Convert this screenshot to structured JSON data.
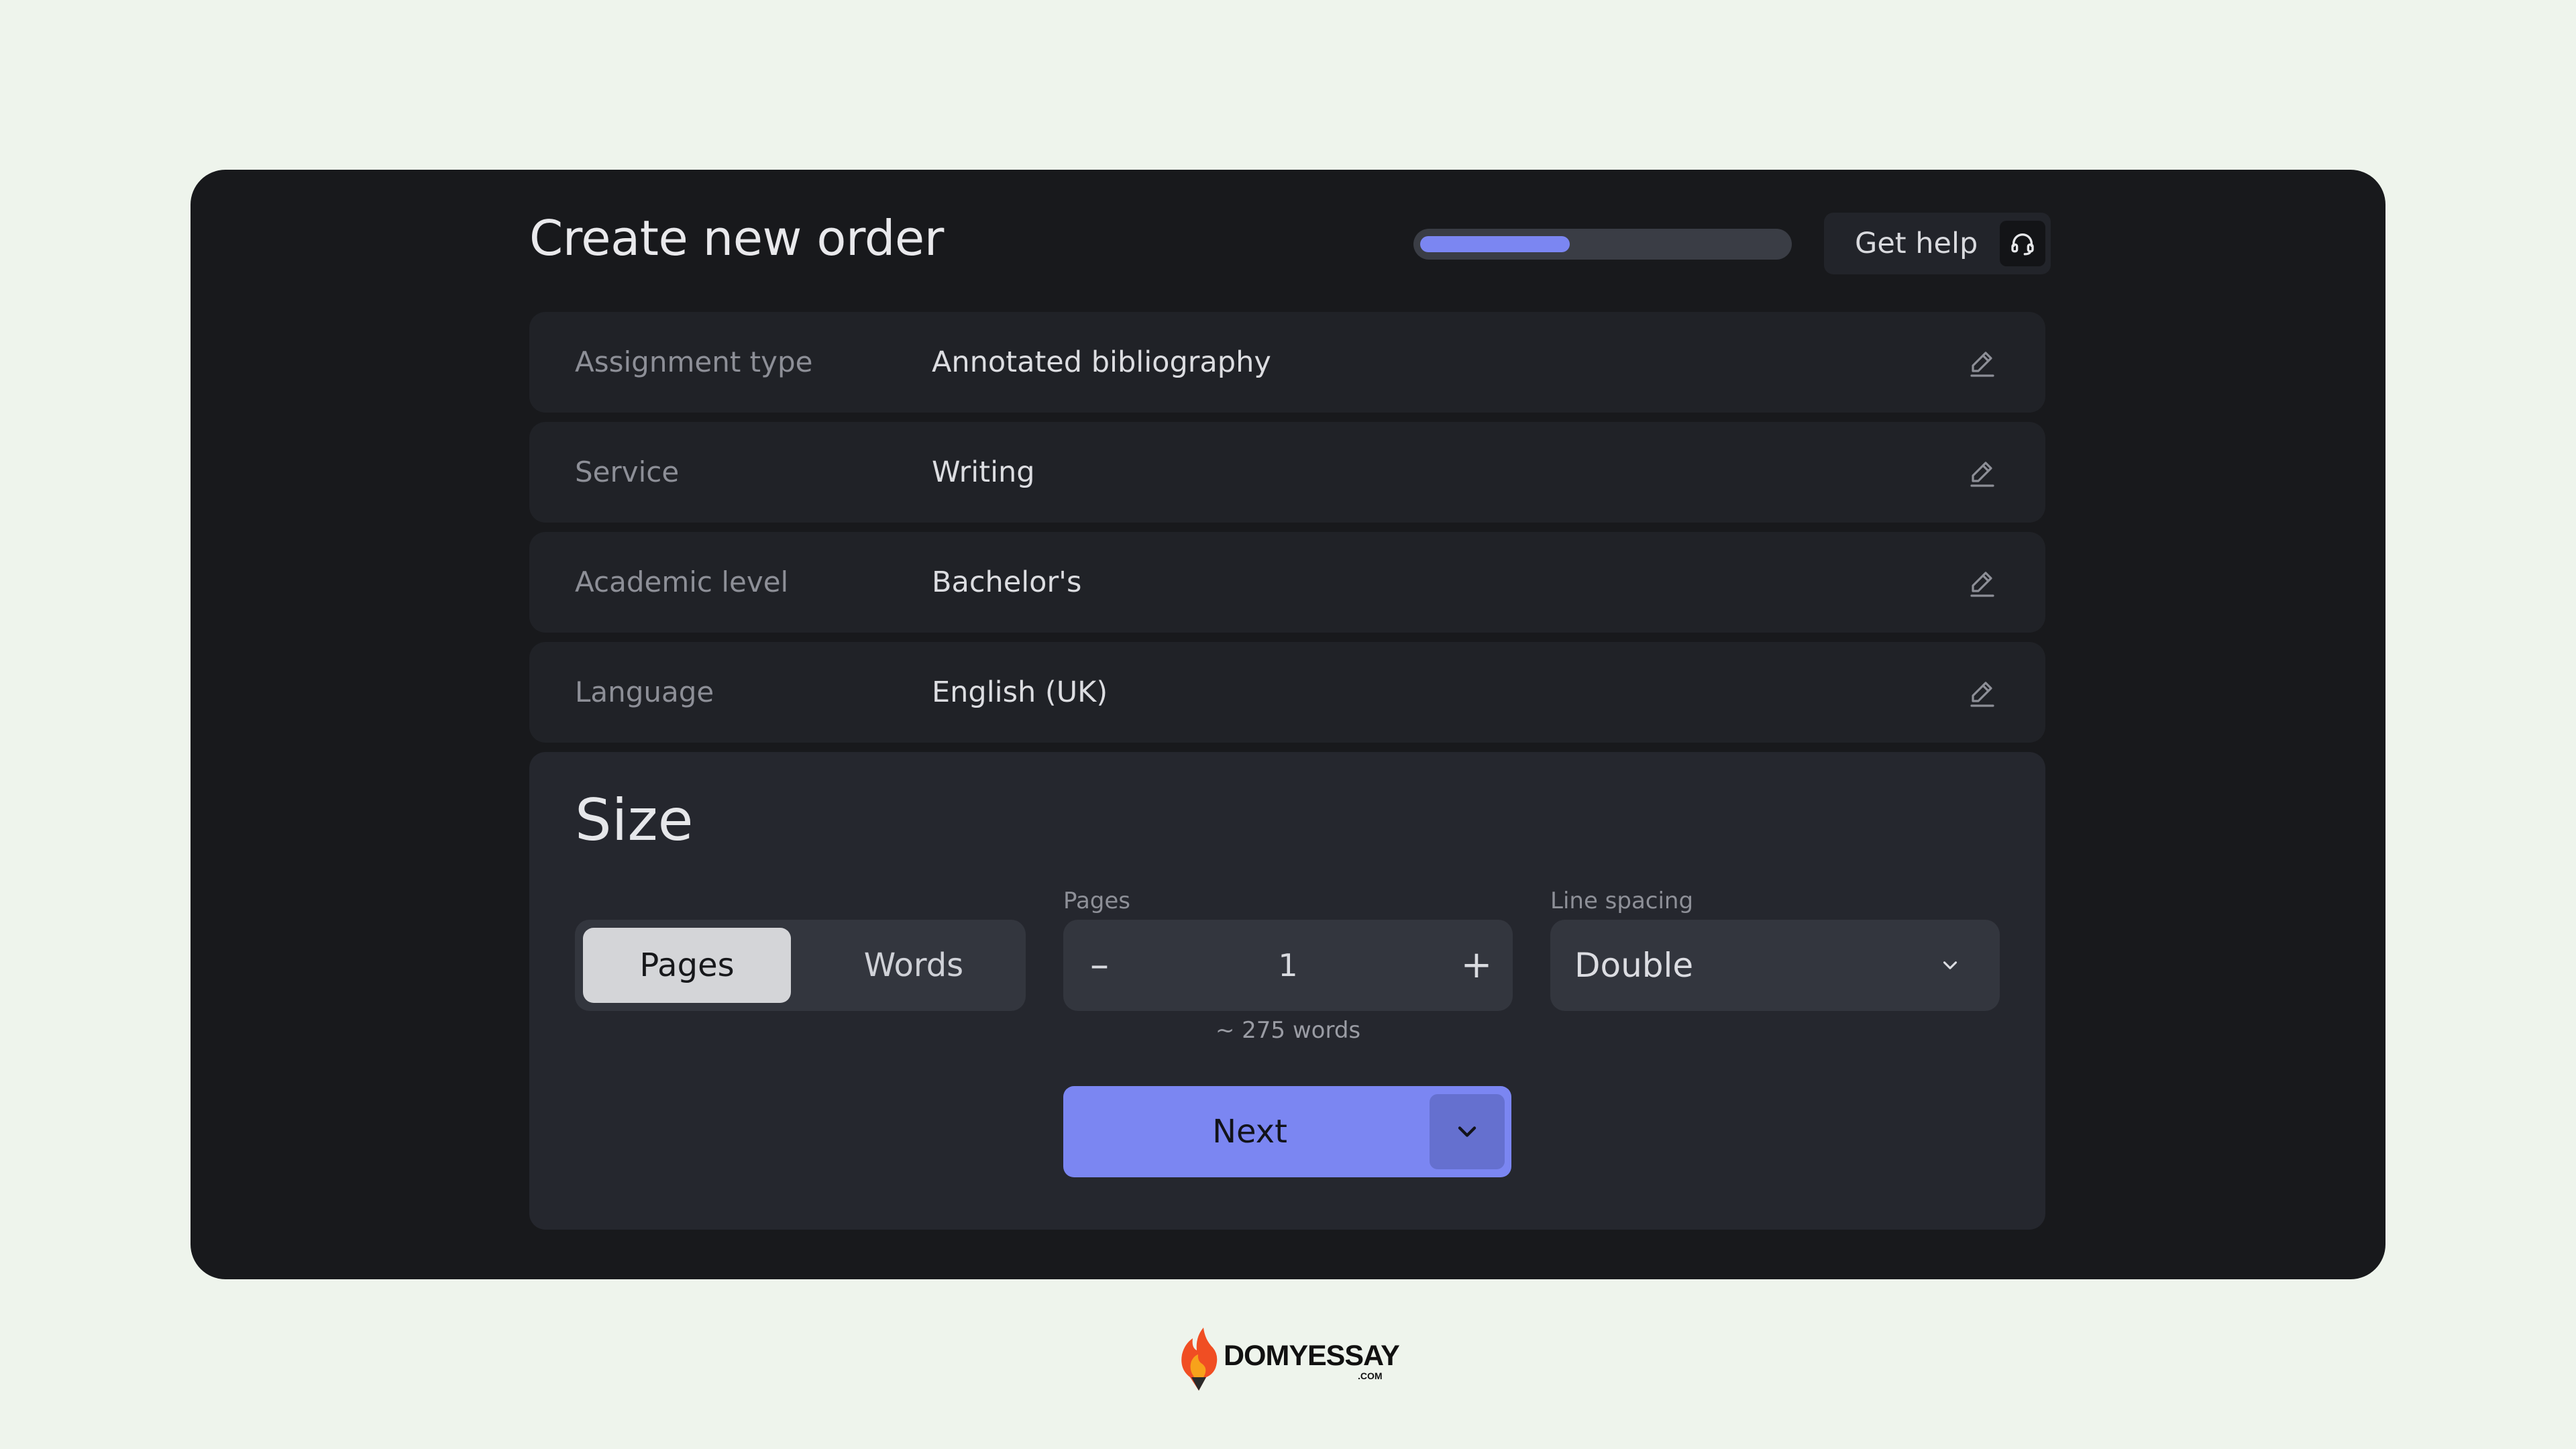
{
  "header": {
    "title": "Create new order",
    "progress": 0.41,
    "help_label": "Get help",
    "help_icon": "headset-icon"
  },
  "summary": {
    "rows": [
      {
        "label": "Assignment type",
        "value": "Annotated bibliography"
      },
      {
        "label": "Service",
        "value": "Writing"
      },
      {
        "label": "Academic level",
        "value": "Bachelor's"
      },
      {
        "label": "Language",
        "value": "English (UK)"
      }
    ]
  },
  "size": {
    "title": "Size",
    "toggle": {
      "options": [
        "Pages",
        "Words"
      ],
      "selected": "Pages"
    },
    "pages": {
      "label": "Pages",
      "value": "1",
      "minus": "–",
      "plus": "+",
      "hint": "~ 275 words"
    },
    "line_spacing": {
      "label": "Line spacing",
      "value": "Double"
    },
    "next_label": "Next"
  },
  "footer": {
    "brand": "DOMYESSAY",
    "brand_suffix": ".COM"
  },
  "colors": {
    "accent": "#7b86f2",
    "card_bg": "#18191c",
    "page_bg": "#eef4ec",
    "flame": "#f04e23"
  }
}
